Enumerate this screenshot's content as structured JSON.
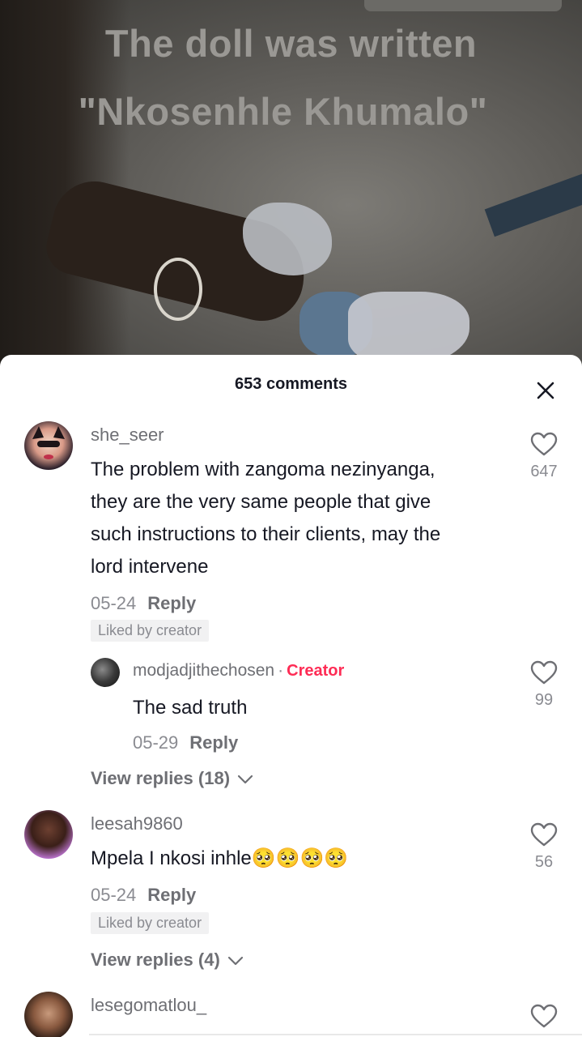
{
  "video": {
    "caption_line1": "The doll was written",
    "caption_line2": "\"Nkosenhle Khumalo\""
  },
  "comments_panel": {
    "title": "653 comments",
    "close_icon": "close-icon"
  },
  "comments": [
    {
      "username": "she_seer",
      "text_lines": [
        "The problem with zangoma nezinyanga,",
        "they are the very same people that give",
        "such instructions to their clients, may the",
        "lord intervene"
      ],
      "date": "05-24",
      "reply_label": "Reply",
      "liked_badge": "Liked by creator",
      "likes": "647",
      "reply": {
        "username": "modjadjithechosen",
        "separator": "·",
        "creator_label": "Creator",
        "text": "The sad truth",
        "date": "05-29",
        "reply_label": "Reply",
        "likes": "99"
      },
      "view_replies": "View replies (18)"
    },
    {
      "username": "leesah9860",
      "text": "Mpela I nkosi inhle",
      "emojis": "🥺🥺🥺🥺",
      "date": "05-24",
      "reply_label": "Reply",
      "liked_badge": "Liked by creator",
      "likes": "56",
      "view_replies": "View replies (4)"
    },
    {
      "username": "lesegomatlou_"
    }
  ]
}
